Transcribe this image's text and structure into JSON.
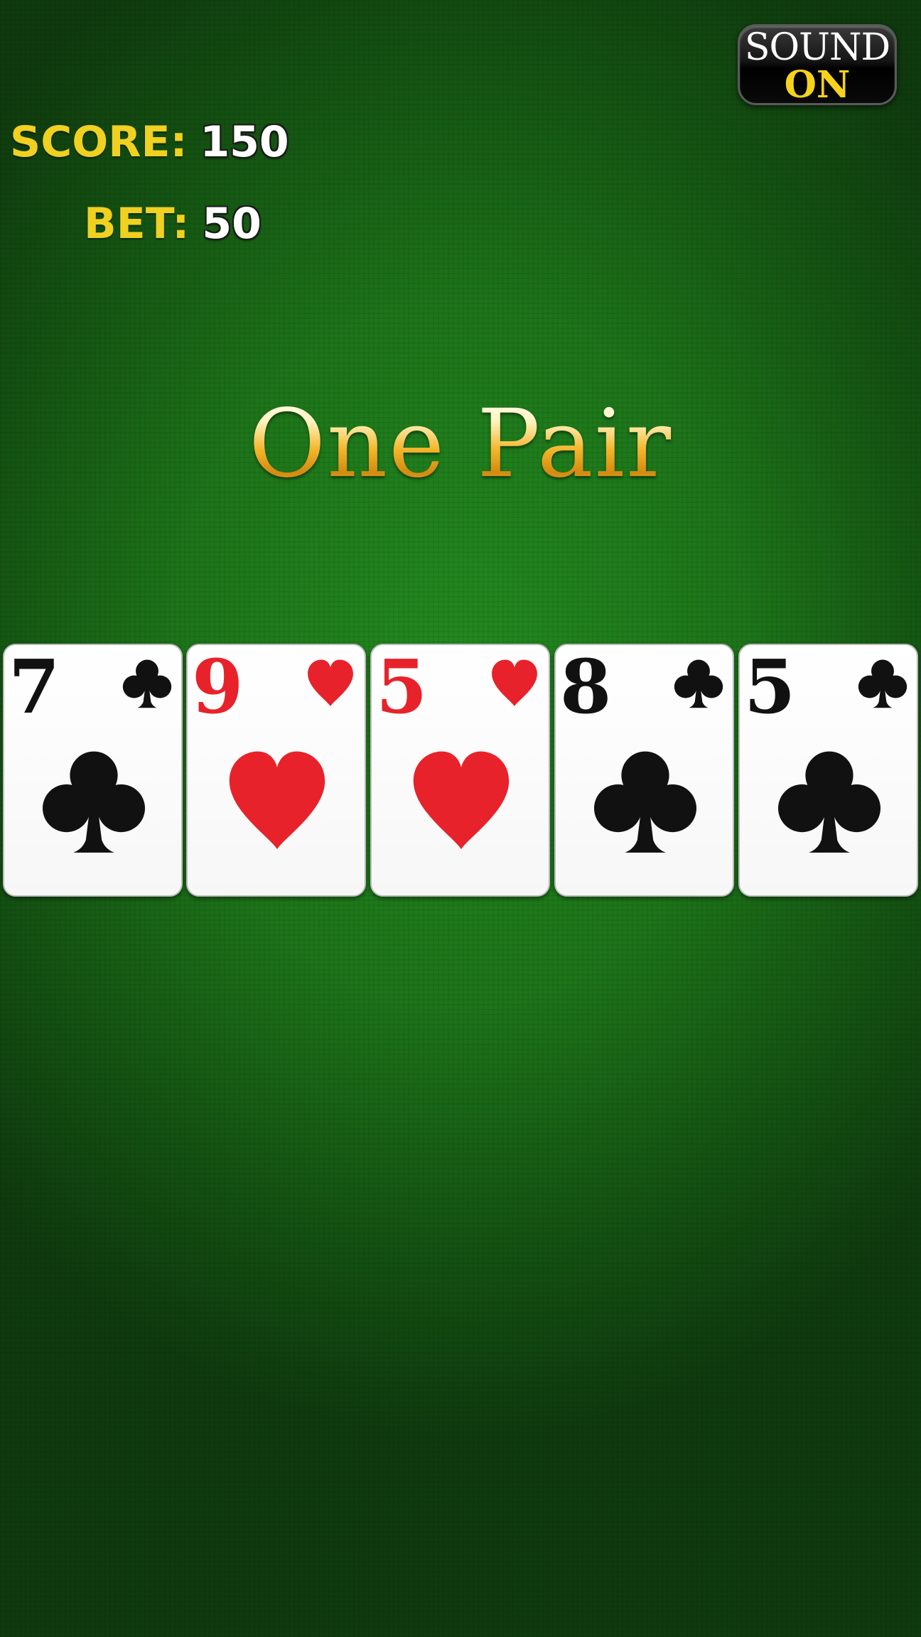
{
  "sound": {
    "line1": "SOUND",
    "line2": "ON"
  },
  "hud": {
    "score_label": "SCORE:",
    "score_value": "150",
    "bet_label": "BET:",
    "bet_value": "50"
  },
  "hand_result": "One Pair",
  "cards": [
    {
      "rank": "7",
      "suit": "club-icon",
      "color": "#111111"
    },
    {
      "rank": "9",
      "suit": "heart-icon",
      "color": "#e8222a"
    },
    {
      "rank": "5",
      "suit": "heart-icon",
      "color": "#e8222a"
    },
    {
      "rank": "8",
      "suit": "club-icon",
      "color": "#111111"
    },
    {
      "rank": "5",
      "suit": "club-icon",
      "color": "#111111"
    }
  ],
  "colors": {
    "felt": "#1d7419",
    "label_yellow": "#f0d020",
    "heart_red": "#e8222a",
    "club_black": "#111111"
  }
}
